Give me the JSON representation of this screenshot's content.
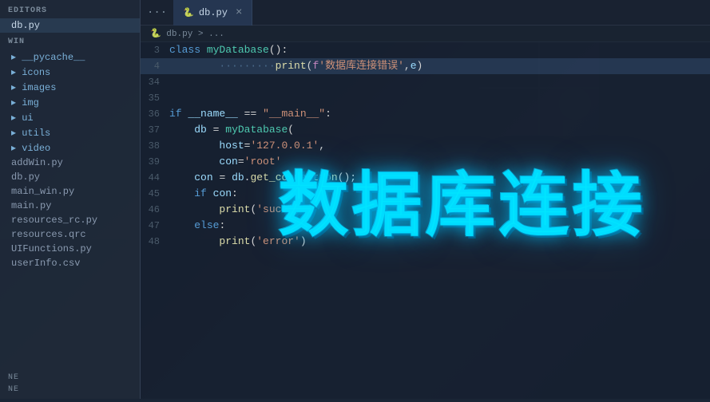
{
  "ide": {
    "tab_dots": "···",
    "tab": {
      "icon": "🐍",
      "label": "db.py",
      "close": "×"
    },
    "breadcrumb": "🐍 db.py > ...",
    "editors_label": "EDITORS",
    "win_label": "WIN",
    "sidebar_files": [
      {
        "name": "db.py",
        "active": true,
        "type": "file"
      },
      {
        "name": "__pycache__",
        "type": "folder"
      },
      {
        "name": "icons",
        "type": "folder"
      },
      {
        "name": "images",
        "type": "folder"
      },
      {
        "name": "img",
        "type": "folder"
      },
      {
        "name": "ui",
        "type": "folder"
      },
      {
        "name": "utils",
        "type": "folder"
      },
      {
        "name": "video",
        "type": "folder"
      },
      {
        "name": "addWin.py",
        "type": "file"
      },
      {
        "name": "db.py",
        "type": "file"
      },
      {
        "name": "main_win.py",
        "type": "file"
      },
      {
        "name": "main.py",
        "type": "file"
      },
      {
        "name": "resources_rc.py",
        "type": "file"
      },
      {
        "name": "resources.qrc",
        "type": "file"
      },
      {
        "name": "UIFunctions.py",
        "type": "file"
      },
      {
        "name": "userInfo.csv",
        "type": "file"
      }
    ],
    "sidebar_bottom": [
      "NE",
      "NE"
    ],
    "code_lines": [
      {
        "num": "3",
        "content": "class myDatabase():"
      },
      {
        "num": "4",
        "content": "        ·········print(f'数据库连接错误',e)",
        "highlight": true
      },
      {
        "num": "34",
        "content": ""
      },
      {
        "num": "35",
        "content": ""
      },
      {
        "num": "36",
        "content": "if __name__ == \"__main__\":"
      },
      {
        "num": "37",
        "content": "    db = myDatabase("
      },
      {
        "num": "38",
        "content": "        host='127.0.0.1',"
      },
      {
        "num": "39",
        "content": "        con='root'"
      },
      {
        "num": "44",
        "content": "    con = db.get_connection()"
      },
      {
        "num": "45",
        "content": "    if con:"
      },
      {
        "num": "46",
        "content": "        print('succ')"
      },
      {
        "num": "47",
        "content": "    else:"
      },
      {
        "num": "48",
        "content": "        print('error')"
      }
    ]
  },
  "overlay": {
    "text": "数据库连接"
  }
}
